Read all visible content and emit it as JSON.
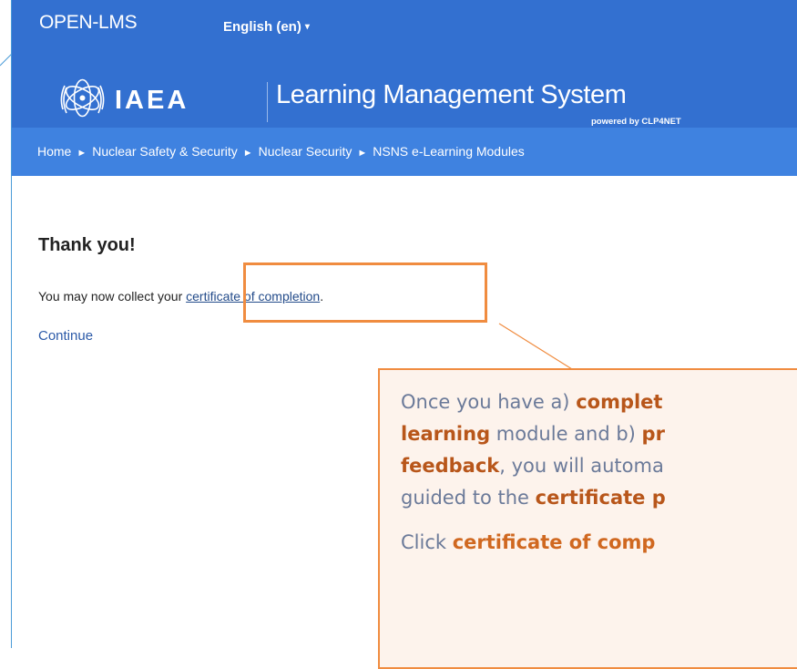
{
  "topbar": {
    "brand": "OPEN-LMS",
    "language": "English (en)",
    "language_caret": "▾"
  },
  "header": {
    "org": "IAEA",
    "title": "Learning Management System",
    "powered_by": "powered by CLP4NET"
  },
  "breadcrumb": {
    "separator": "►",
    "items": [
      "Home",
      "Nuclear Safety & Security",
      "Nuclear Security",
      "NSNS e-Learning Modules"
    ]
  },
  "main": {
    "heading": "Thank you!",
    "message_prefix": "You may now collect your ",
    "certificate_link": "certificate of completion",
    "message_suffix": ".",
    "continue_link": "Continue"
  },
  "callout": {
    "line1_prefix": "Once you have a) ",
    "line1_bold": "complet",
    "line2_bold": "learning",
    "line2_rest": " module and b) ",
    "line2_bold2": "pr",
    "line3_bold": "feedback",
    "line3_rest": ", you will automa",
    "line4_prefix": "guided to the ",
    "line4_bold": "certificate p",
    "line5_prefix": "Click ",
    "line5_link": "certificate of comp"
  },
  "colors": {
    "header_blue": "#3370d0",
    "breadcrumb_blue": "#3f82e0",
    "highlight_orange": "#f08c40"
  }
}
